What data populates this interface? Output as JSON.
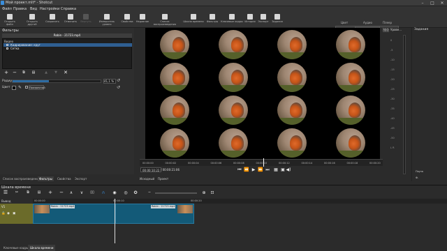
{
  "window": {
    "title": "Мой проект.mlt* - Shotcut"
  },
  "menu": [
    "Файл",
    "Правка",
    "Вид",
    "Настройки",
    "Справка"
  ],
  "toolbar": [
    {
      "label": "Открыть файл",
      "icon": "folder-open-icon"
    },
    {
      "label": "Открыть другой",
      "icon": "folder-other-icon"
    },
    {
      "label": "Сохранить",
      "icon": "save-icon"
    },
    {
      "label": "Отменить",
      "icon": "undo-icon"
    },
    {
      "label": "Вернуть",
      "icon": "redo-icon",
      "disabled": true
    },
    {
      "label": "Измеритель уровня",
      "icon": "audio-meter-icon"
    },
    {
      "label": "Свойства",
      "icon": "info-icon"
    },
    {
      "label": "Недавние",
      "icon": "recent-icon"
    },
    {
      "label": "Список воспроизведения",
      "icon": "playlist-icon"
    },
    {
      "label": "Шкала времени",
      "icon": "timeline-icon"
    },
    {
      "label": "Фильтры",
      "icon": "filters-icon"
    },
    {
      "label": "Ключевые кадры",
      "icon": "keyframes-icon"
    },
    {
      "label": "История",
      "icon": "history-icon"
    },
    {
      "label": "Экспорт",
      "icon": "export-icon"
    },
    {
      "label": "Задания",
      "icon": "jobs-icon"
    }
  ],
  "layouts": {
    "items": [
      "Логирование",
      "Редактирование",
      "Эффекты"
    ],
    "active": "Редактирование",
    "sub": [
      "Цвет",
      "Аудио",
      "Плеер"
    ]
  },
  "filters": {
    "title": "Фильтры",
    "clip_name": "Robin - 21723.mp4",
    "video_section": "Видео",
    "items": [
      {
        "label": "Кадрирование: круг",
        "checked": true,
        "selected": true
      },
      {
        "label": "Сетка",
        "checked": true,
        "selected": false
      }
    ],
    "radius_label": "Радиус",
    "radius_value": "41,1 %",
    "radius_fraction": 0.411,
    "color_label": "Цвет",
    "transparent_label": "Прозрачный"
  },
  "dock_tabs": [
    "Список воспроизведения",
    "Фильтры",
    "Свойства",
    "Экспорт"
  ],
  "player": {
    "ruler_ticks": [
      "00:00:00",
      "00:00:02",
      "00:00:04",
      "00:00:06",
      "00:00:08",
      "00:00:10",
      "00:00:12",
      "00:00:14",
      "00:00:16",
      "00:00:18",
      "00:00:20"
    ],
    "current_time": "00:00:10:22",
    "total_time": "/ 00:00:21:06",
    "source_tab": "Исходный",
    "project_tab": "Проект",
    "grid_rows": 4,
    "grid_cols": 4
  },
  "meters": {
    "labels": [
      "0",
      "-5",
      "-10",
      "-15",
      "-20",
      "-25",
      "-30",
      "-35",
      "-40",
      "-45",
      "-50",
      "L R"
    ]
  },
  "jobs": {
    "title": "Задания",
    "pause_label": "Пауза",
    "menu_label": "Ф."
  },
  "meter_title": "Урове...",
  "timeline": {
    "title": "Шкала времени",
    "track_section": "Вывод",
    "track_name": "V1",
    "ruler_ticks": [
      "00:00:00",
      "00:00:10",
      "00:00:20"
    ],
    "clips": [
      {
        "label": "Robin - 21723.mp4"
      },
      {
        "label": "Robin - 21723.mp4"
      }
    ]
  },
  "bottom_tabs": [
    "Ключевые кадры",
    "Шкала времени"
  ]
}
